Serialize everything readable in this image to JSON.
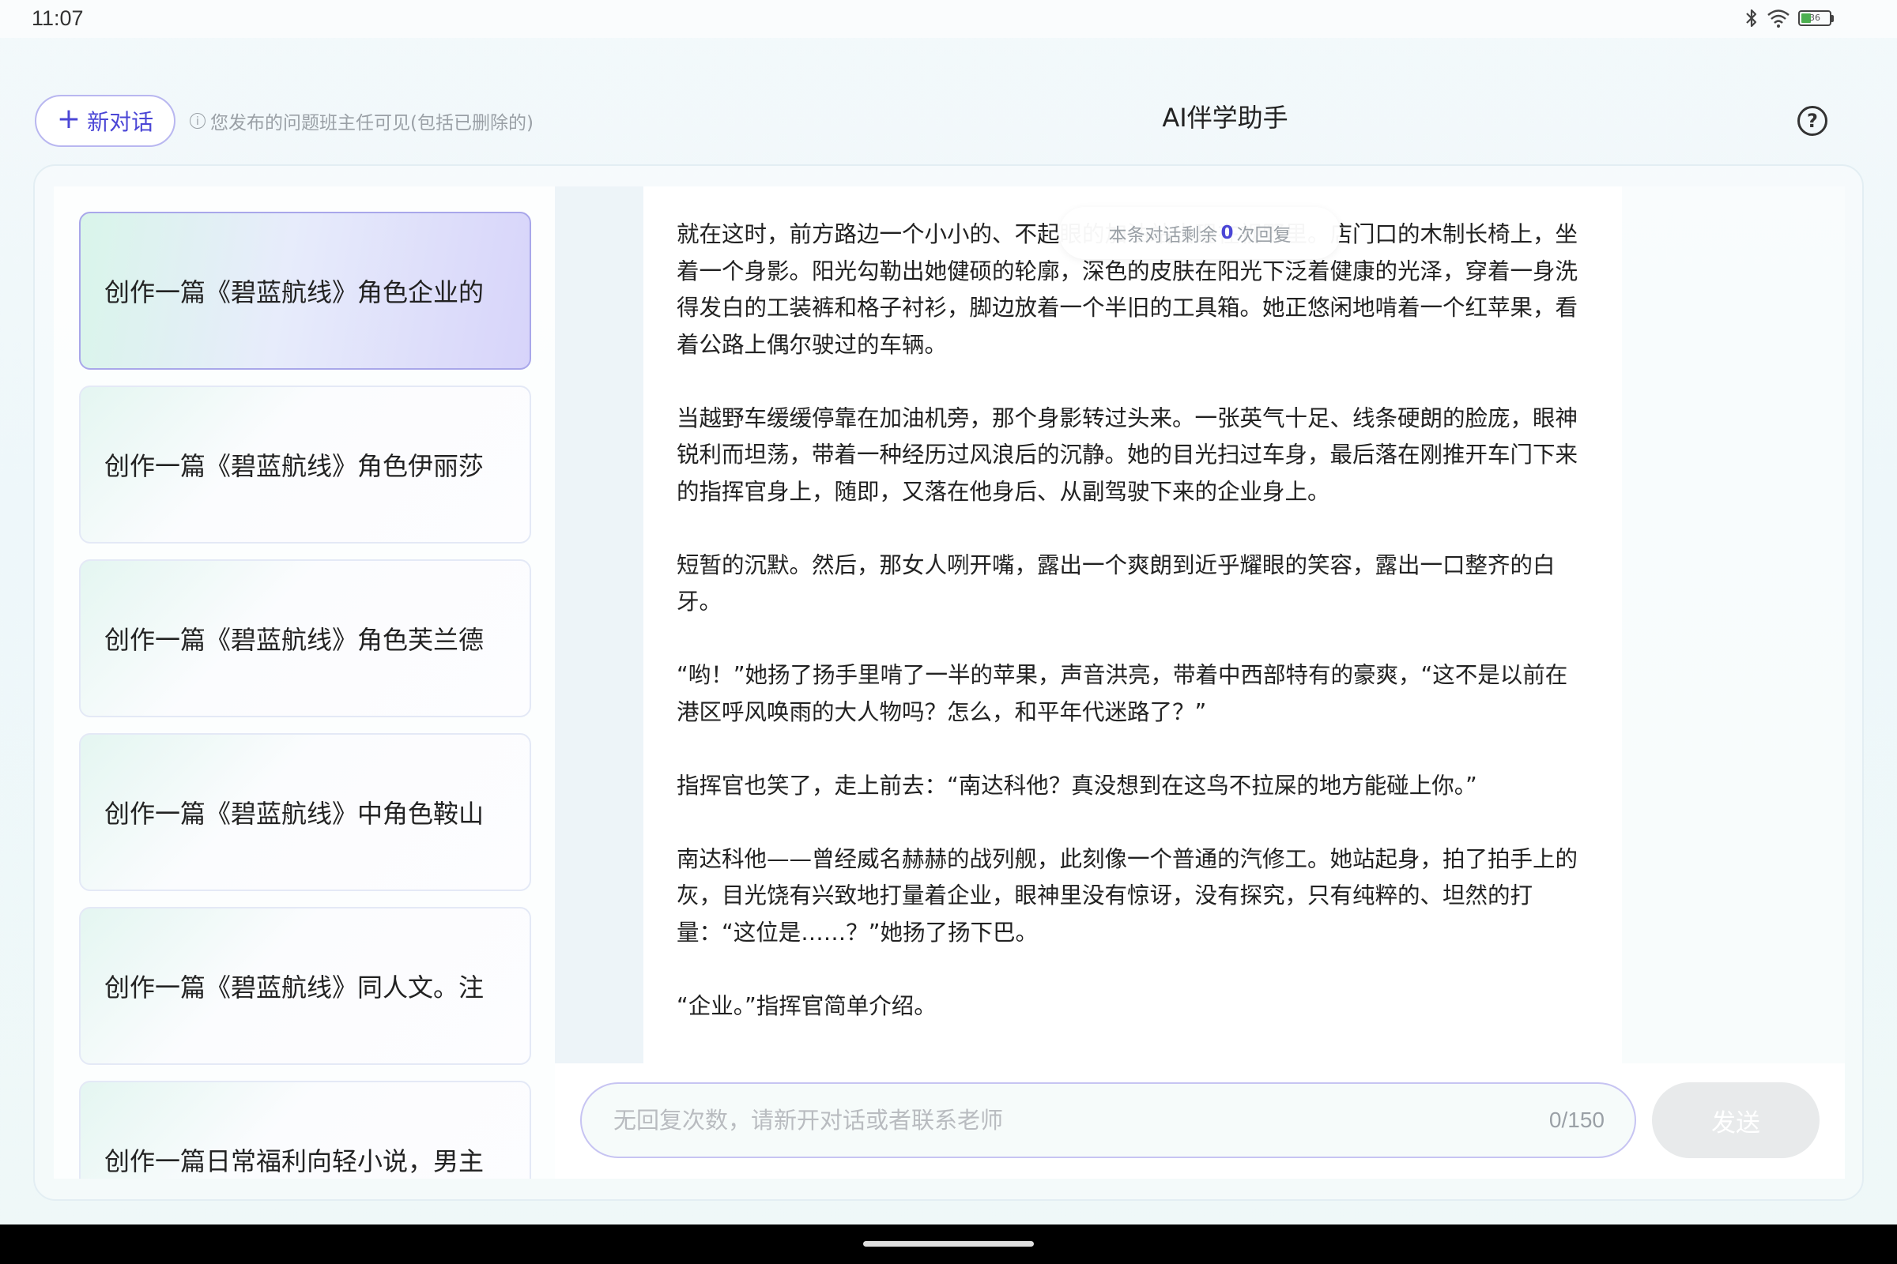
{
  "status_bar": {
    "time": "11:07",
    "battery_level": "36",
    "battery_fraction": 0.36,
    "icons": [
      "bluetooth-icon",
      "wifi-icon",
      "battery-icon"
    ]
  },
  "header": {
    "new_chat_label": "新对话",
    "notice": "您发布的问题班主任可见(包括已删除的)",
    "title": "AI伴学助手"
  },
  "sidebar": {
    "items": [
      {
        "label": "创作一篇《碧蓝航线》角色企业的"
      },
      {
        "label": "创作一篇《碧蓝航线》角色伊丽莎"
      },
      {
        "label": "创作一篇《碧蓝航线》角色芙兰德"
      },
      {
        "label": "创作一篇《碧蓝航线》中角色鞍山"
      },
      {
        "label": "创作一篇《碧蓝航线》同人文。注"
      },
      {
        "label": "创作一篇日常福利向轻小说，男主"
      }
    ]
  },
  "message": {
    "paragraphs": [
      "就在这时，前方路边一个小小的、不起眼的加油站出现在视野里。店门口的木制长椅上，坐着一个身影。阳光勾勒出她健硕的轮廓，深色的皮肤在阳光下泛着健康的光泽，穿着一身洗得发白的工装裤和格子衬衫，脚边放着一个半旧的工具箱。她正悠闲地啃着一个红苹果，看着公路上偶尔驶过的车辆。",
      "当越野车缓缓停靠在加油机旁，那个身影转过头来。一张英气十足、线条硬朗的脸庞，眼神锐利而坦荡，带着一种经历过风浪后的沉静。她的目光扫过车身，最后落在刚推开车门下来的指挥官身上，随即，又落在他身后、从副驾驶下来的企业身上。",
      "短暂的沉默。然后，那女人咧开嘴，露出一个爽朗到近乎耀眼的笑容，露出一口整齐的白牙。",
      "“哟！”她扬了扬手里啃了一半的苹果，声音洪亮，带着中西部特有的豪爽，“这不是以前在港区呼风唤雨的大人物吗？怎么，和平年代迷路了？”",
      "指挥官也笑了，走上前去：“南达科他？真没想到在这鸟不拉屎的地方能碰上你。”",
      "南达科他——曾经威名赫赫的战列舰，此刻像一个普通的汽修工。她站起身，拍了拍手上的灰，目光饶有兴致地打量着企业，眼神里没有惊讶，没有探究，只有纯粹的、坦然的打量：“这位是……？”她扬了扬下巴。",
      "“企业。”指挥官简单介绍。"
    ]
  },
  "remaining": {
    "prefix": "本条对话剩余",
    "count": "0",
    "suffix": "次回复"
  },
  "input": {
    "placeholder": "无回复次数，请新开对话或者联系老师",
    "value": "",
    "counter": "0/150",
    "send_label": "发送"
  }
}
